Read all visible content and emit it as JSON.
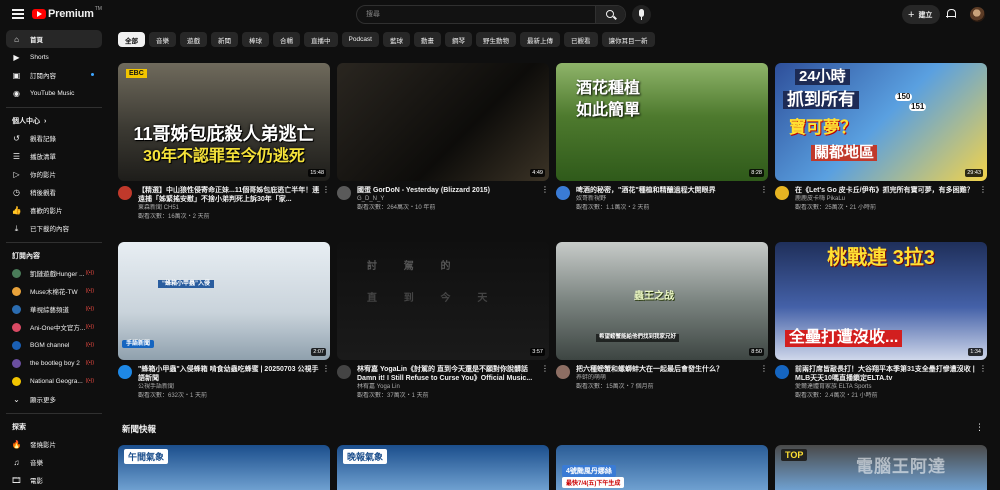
{
  "header": {
    "logo_text": "Premium",
    "logo_tm": "TM",
    "search_placeholder": "搜尋",
    "create_label": "建立"
  },
  "sidebar": {
    "main": [
      {
        "label": "首頁",
        "icon": "home-icon",
        "glyph": "⌂",
        "active": true
      },
      {
        "label": "Shorts",
        "icon": "shorts-icon",
        "glyph": "▶"
      },
      {
        "label": "訂閱內容",
        "icon": "subscriptions-icon",
        "glyph": "▣",
        "dot": true
      },
      {
        "label": "YouTube Music",
        "icon": "music-icon",
        "glyph": "◉"
      }
    ],
    "you_heading": "個人中心",
    "you_heading_arrow": "›",
    "you": [
      {
        "label": "觀看記錄",
        "icon": "history-icon",
        "glyph": "↺"
      },
      {
        "label": "播放清單",
        "icon": "playlists-icon",
        "glyph": "☰"
      },
      {
        "label": "你的影片",
        "icon": "your-videos-icon",
        "glyph": "▷"
      },
      {
        "label": "稍後觀看",
        "icon": "watch-later-icon",
        "glyph": "◷"
      },
      {
        "label": "喜歡的影片",
        "icon": "liked-icon",
        "glyph": "👍"
      },
      {
        "label": "已下載的內容",
        "icon": "downloads-icon",
        "glyph": "⤓"
      }
    ],
    "subs_heading": "訂閱內容",
    "subs": [
      {
        "label": "凱鏈遊戲Hunger ...",
        "color": "#4a7c59",
        "live": "((•))"
      },
      {
        "label": "Muse木棉花-TW",
        "color": "#e8a23a",
        "live": "((•))"
      },
      {
        "label": "華視綜藝頻道",
        "color": "#2b6cb0",
        "live": "((•))"
      },
      {
        "label": "Ani-One中文官方...",
        "color": "#d94a64",
        "live": "((•))"
      },
      {
        "label": "BGM channel",
        "color": "#1a5fb4",
        "live": "((•))"
      },
      {
        "label": "the bootleg boy 2",
        "color": "#6b4fa0",
        "live": "((•))"
      },
      {
        "label": "National Geogra...",
        "color": "#f2c500",
        "live": "((•))"
      }
    ],
    "show_more": "顯示更多",
    "explore_heading": "探索",
    "explore": [
      {
        "label": "發燒影片",
        "icon": "trending-icon",
        "glyph": "🔥"
      },
      {
        "label": "音樂",
        "icon": "music-note-icon",
        "glyph": "♫"
      },
      {
        "label": "電影",
        "icon": "movies-icon",
        "glyph": "🎞"
      }
    ]
  },
  "chips": [
    "全部",
    "音樂",
    "遊戲",
    "新聞",
    "棒球",
    "合輯",
    "直播中",
    "Podcast",
    "藍球",
    "動畫",
    "鋼琴",
    "野生動物",
    "最新上傳",
    "已觀看",
    "讓你耳目一新"
  ],
  "videos": [
    {
      "title": "【精選】中山狼性侵寄命正妹...11個哥姊包庇逃亡半年！連遠捕「姊緊搖安慰」不捨小弟判死上訴30年「家...",
      "channel": "東森新聞 CH51",
      "stats": "觀看次數：16萬次・2 天前",
      "duration": "15:48",
      "thumb_line1": "11哥姊包庇殺人弟逃亡",
      "thumb_line2": "30年不認罪至今仍逃死",
      "ebc": "EBC"
    },
    {
      "title": "國蛋 GorDoN - Yesterday (Blizzard 2015)",
      "channel": "G_D_N_Y",
      "stats": "觀看次數：264萬次・10 年前",
      "duration": "4:49"
    },
    {
      "title": "啤酒的秘密，\"酒花\"種植和精釀過程大開眼界",
      "channel": "奴哥新視野",
      "stats": "觀看次數：1.1萬次・2 天前",
      "duration": "8:28",
      "thumb_line1": "酒花種植",
      "thumb_line2": "如此簡單"
    },
    {
      "title": "在《Let's Go 皮卡丘/伊布》抓完所有寶可夢，有多困難？",
      "channel": "鹿鹿皮卡嗨 PikaLu",
      "stats": "觀看次數：25萬次・21 小時前",
      "duration": "29:43",
      "thumb_line1": "24小時",
      "thumb_line2": "抓到所有",
      "thumb_line3": "寶可夢？",
      "thumb_line4": "關都地區",
      "badge1": "150",
      "badge2": "151"
    },
    {
      "title": "\"蜂箱小甲蟲\"入侵蜂箱 啃食幼蟲吃蜂蜜 | 20250703 公視手語新聞",
      "channel": "公視手語新聞",
      "stats": "觀看次數：632次・1 天前",
      "duration": "2:07",
      "thumb_caption": "“蜂箱小甲蟲”入侵",
      "thumb_tag": "手語新聞"
    },
    {
      "title": "林宥嘉 YogaLin《討駕的 直到今天還是不願對你說髒話 Damn it! I Still Refuse to Curse You》Official Music...",
      "channel": "林宥嘉 Yoga Lin",
      "stats": "觀看次數：37萬次・1 天前",
      "duration": "3:57",
      "thumb_line1": "討 駕 的",
      "thumb_line2": "直 到 今 天"
    },
    {
      "title": "把六種螃蟹和螺螄蚌大在一起最后會發生什么？",
      "channel": "养蚌的萌萌",
      "stats": "觀看次數：15萬次・7 個月前",
      "duration": "8:50",
      "thumb_line1": "蟲王之战",
      "thumb_caption": "希望螃蟹能給他們找到我家兄好"
    },
    {
      "title": "前兩打席皆敲長打！大谷翔平本季第31支全壘打慘遭沒收 | MLB天天10嗎直播鎖定ELTA.tv",
      "channel": "愛爾達體育家族 ELTA Sports",
      "stats": "觀看次數：2.4萬次・21 小時前",
      "duration": "1:34",
      "thumb_line1": "桃戰連 3拉3",
      "thumb_line2": "全壘打遭沒收..."
    }
  ],
  "news": {
    "heading": "新聞快報",
    "thumbs": [
      {
        "label": "午間氣象",
        "bg": "#1b4e8c"
      },
      {
        "label": "晚報氣象",
        "bg": "#1b4e8c"
      },
      {
        "label": "4號颱風丹娜絲",
        "sub": "最快7/4(五)下午生成",
        "bg": "#2a5c96"
      },
      {
        "label": "TOP",
        "bg": "#4a4a4a"
      }
    ]
  },
  "watermark": "電腦王阿達"
}
